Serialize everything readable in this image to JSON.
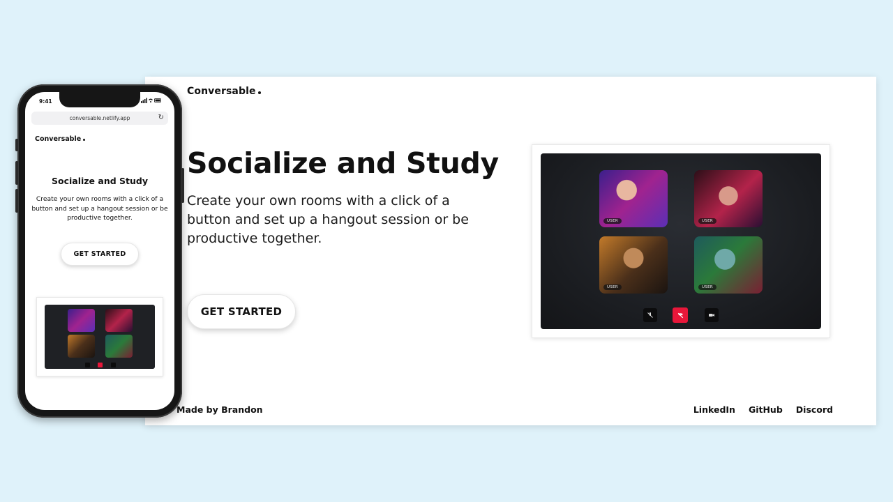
{
  "desktop": {
    "brand": "Conversable",
    "hero": {
      "title": "Socialize and Study",
      "subtitle": "Create your own rooms with a click of a button and set up a hangout session or be productive together.",
      "cta_label": "GET STARTED"
    },
    "preview": {
      "tiles": [
        {
          "label": "USER"
        },
        {
          "label": "USER"
        },
        {
          "label": "USER"
        },
        {
          "label": "USER"
        }
      ],
      "controls": [
        {
          "icon": "mic-off-icon"
        },
        {
          "icon": "hang-up-icon",
          "color": "#e8173a"
        },
        {
          "icon": "camera-icon"
        }
      ]
    },
    "footer": {
      "credit": "Made by Brandon",
      "links": [
        "LinkedIn",
        "GitHub",
        "Discord"
      ]
    }
  },
  "phone": {
    "status_time": "9:41",
    "url": "conversable.netlify.app",
    "brand": "Conversable",
    "title": "Socialize and Study",
    "subtitle": "Create your own rooms with a click of a button and set up a hangout session or be productive together.",
    "cta_label": "GET STARTED"
  },
  "colors": {
    "background": "#dff2fa",
    "accent_red": "#e8173a",
    "text": "#111111"
  }
}
